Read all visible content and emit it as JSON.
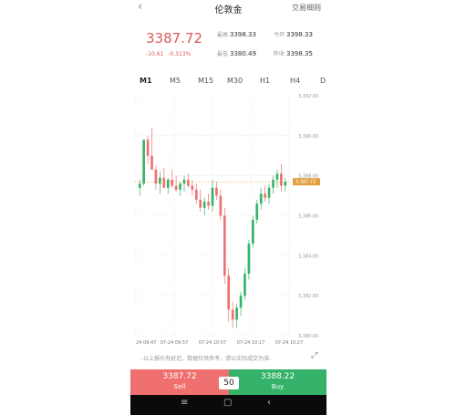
{
  "header": {
    "back_icon": "chevron-left-icon",
    "title": "伦敦金",
    "detail_link": "交易细则"
  },
  "quote": {
    "price": "3387.72",
    "change": "-10.61",
    "change_pct": "-0.313%",
    "high_label": "最高",
    "high": "3398.33",
    "low_label": "最低",
    "low": "3380.49",
    "open_label": "今开",
    "open": "3398.33",
    "prev_close_label": "昨收",
    "prev_close": "3398.35"
  },
  "tabs": [
    "M1",
    "M5",
    "M15",
    "M30",
    "H1",
    "H4",
    "D"
  ],
  "active_tab": "M1",
  "chart_data": {
    "type": "candlestick",
    "y_tick_labels": [
      "3,392.00",
      "3,390.00",
      "3,388.00",
      "3,386.00",
      "3,384.00",
      "3,382.00",
      "3,380.00"
    ],
    "x_tick_labels": [
      "24 09:47",
      "07-24 09:57",
      "07-24 10:07",
      "07-24 10:17",
      "07-24 10:27"
    ],
    "current_price_label": "3,387.72",
    "ylim": [
      3380.0,
      3392.0
    ],
    "up_color": "#35b26a",
    "down_color": "#f07070",
    "candles": [
      [
        3387.4,
        3387.8,
        3387.0,
        3387.6
      ],
      [
        3387.6,
        3389.8,
        3387.5,
        3389.8
      ],
      [
        3389.8,
        3390.0,
        3388.6,
        3389.0
      ],
      [
        3389.0,
        3390.4,
        3388.4,
        3388.3
      ],
      [
        3388.3,
        3388.5,
        3387.3,
        3387.6
      ],
      [
        3387.6,
        3388.2,
        3387.1,
        3387.9
      ],
      [
        3387.9,
        3388.4,
        3387.4,
        3387.4
      ],
      [
        3387.4,
        3387.9,
        3387.1,
        3387.8
      ],
      [
        3387.8,
        3388.3,
        3387.4,
        3387.5
      ],
      [
        3387.5,
        3388.0,
        3387.2,
        3387.3
      ],
      [
        3387.3,
        3387.7,
        3387.0,
        3387.6
      ],
      [
        3387.6,
        3388.0,
        3387.2,
        3387.8
      ],
      [
        3387.8,
        3388.1,
        3387.4,
        3387.5
      ],
      [
        3387.5,
        3387.8,
        3387.0,
        3387.3
      ],
      [
        3387.3,
        3387.6,
        3386.6,
        3386.8
      ],
      [
        3386.8,
        3387.3,
        3386.2,
        3386.4
      ],
      [
        3386.4,
        3386.9,
        3386.0,
        3386.7
      ],
      [
        3386.7,
        3387.1,
        3386.3,
        3386.5
      ],
      [
        3386.5,
        3387.8,
        3386.2,
        3387.4
      ],
      [
        3387.4,
        3387.7,
        3386.8,
        3387.0
      ],
      [
        3387.0,
        3387.3,
        3385.8,
        3386.0
      ],
      [
        3386.0,
        3386.4,
        3382.6,
        3383.0
      ],
      [
        3383.0,
        3383.4,
        3380.7,
        3381.3
      ],
      [
        3381.3,
        3381.7,
        3380.4,
        3380.8
      ],
      [
        3380.8,
        3381.6,
        3380.4,
        3381.4
      ],
      [
        3381.4,
        3382.2,
        3381.0,
        3382.0
      ],
      [
        3382.0,
        3383.4,
        3381.8,
        3383.1
      ],
      [
        3383.1,
        3384.8,
        3382.8,
        3384.6
      ],
      [
        3384.6,
        3386.0,
        3384.4,
        3385.8
      ],
      [
        3385.8,
        3386.8,
        3385.6,
        3386.6
      ],
      [
        3386.6,
        3387.4,
        3386.3,
        3387.1
      ],
      [
        3387.1,
        3387.5,
        3386.7,
        3386.9
      ],
      [
        3386.9,
        3387.6,
        3386.6,
        3387.4
      ],
      [
        3387.4,
        3388.0,
        3387.1,
        3387.8
      ],
      [
        3387.8,
        3388.3,
        3387.4,
        3388.1
      ],
      [
        3388.1,
        3388.6,
        3387.2,
        3387.5
      ],
      [
        3387.5,
        3387.9,
        3387.2,
        3387.7
      ]
    ]
  },
  "disclaimer": "-以上报价有延迟，数据仅供参考，请以实际成交为准-",
  "expand_icon": "expand-arrows-icon",
  "trade": {
    "sell_price": "3387.72",
    "sell_label": "Sell",
    "lot": "50",
    "buy_price": "3388.22",
    "buy_label": "Buy"
  },
  "system_nav": {
    "menu_icon": "menu-lines-icon",
    "home_icon": "home-square-icon",
    "back_icon": "back-chevron-icon"
  }
}
